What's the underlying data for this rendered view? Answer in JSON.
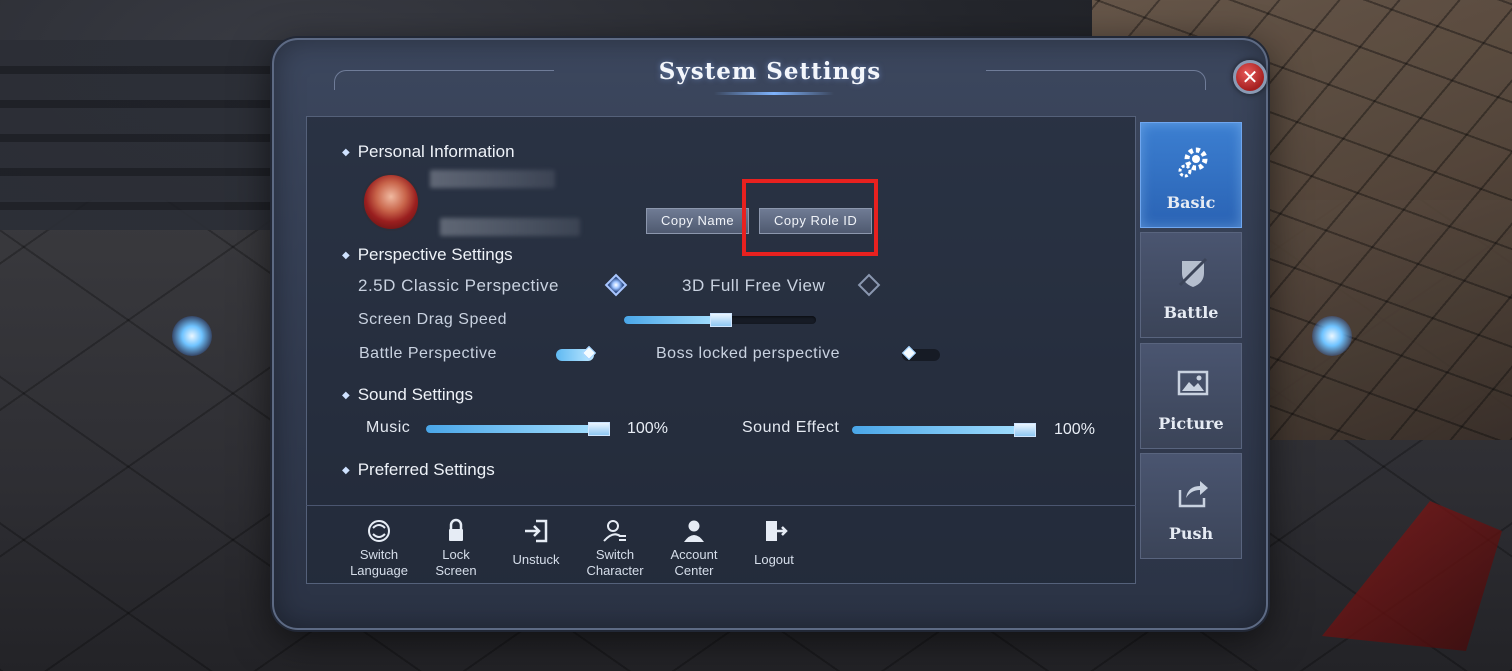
{
  "window": {
    "title": "System Settings"
  },
  "close": {
    "icon": "close-icon",
    "glyph": "✕"
  },
  "personal": {
    "heading": "Personal Information",
    "copy_name_label": "Copy Name",
    "copy_role_id_label": "Copy Role ID"
  },
  "perspective": {
    "heading": "Perspective Settings",
    "classic_label": "2.5D Classic Perspective",
    "classic_selected": true,
    "free_label": "3D Full Free View",
    "free_selected": false,
    "drag_speed_label": "Screen Drag Speed",
    "drag_speed_value": 0.5,
    "battle_label": "Battle Perspective",
    "battle_on": true,
    "boss_label": "Boss locked perspective",
    "boss_on": false
  },
  "sound": {
    "heading": "Sound Settings",
    "music_label": "Music",
    "music_value": "100%",
    "music_level": 1.0,
    "effect_label": "Sound Effect",
    "effect_value": "100%",
    "effect_level": 1.0
  },
  "preferred": {
    "heading": "Preferred Settings"
  },
  "actions": [
    {
      "icon": "switch-language-icon",
      "line1": "Switch",
      "line2": "Language"
    },
    {
      "icon": "lock-icon",
      "line1": "Lock",
      "line2": "Screen"
    },
    {
      "icon": "unstuck-icon",
      "label": "Unstuck"
    },
    {
      "icon": "switch-character-icon",
      "line1": "Switch",
      "line2": "Character"
    },
    {
      "icon": "account-icon",
      "line1": "Account",
      "line2": "Center"
    },
    {
      "icon": "logout-icon",
      "label": "Logout"
    }
  ],
  "tabs": [
    {
      "icon": "gear-icon",
      "label": "Basic",
      "active": true
    },
    {
      "icon": "battle-icon",
      "label": "Battle",
      "active": false
    },
    {
      "icon": "picture-icon",
      "label": "Picture",
      "active": false
    },
    {
      "icon": "push-icon",
      "label": "Push",
      "active": false
    }
  ],
  "colors": {
    "accent": "#3c7fd1",
    "highlight": "#e8211f",
    "slider_fill": "#a7e1ff"
  }
}
